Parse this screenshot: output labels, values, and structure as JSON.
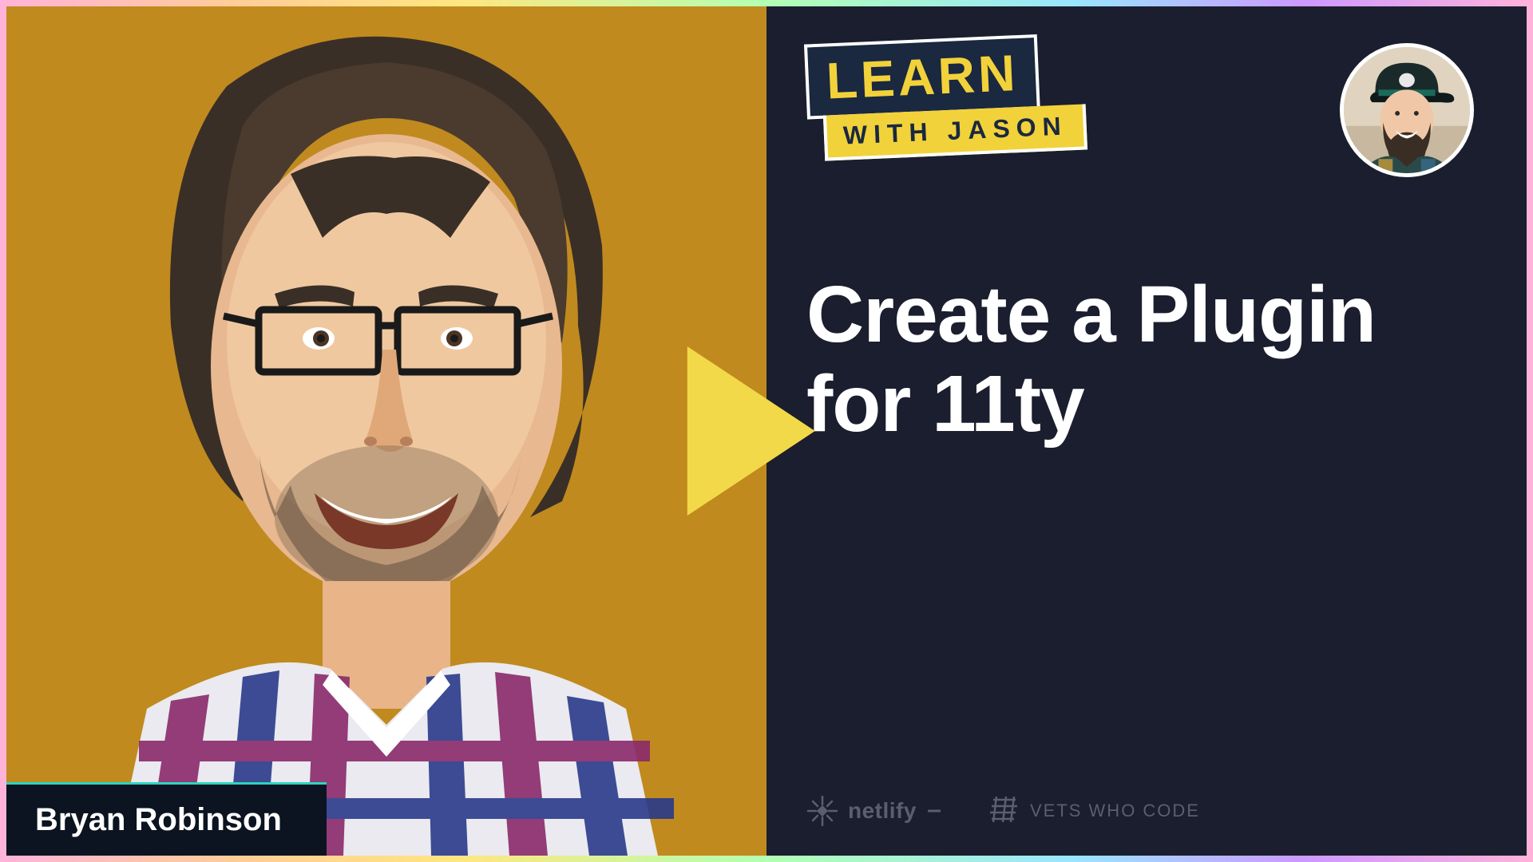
{
  "guest": {
    "name": "Bryan Robinson"
  },
  "logo": {
    "line1": "LEARN",
    "line2": "WITH JASON"
  },
  "episode": {
    "title": "Create a Plugin for 11ty"
  },
  "sponsors": [
    {
      "icon": "netlify-icon",
      "label": "netlify"
    },
    {
      "icon": "vets-who-code-icon",
      "label": "VETS WHO CODE"
    }
  ],
  "icons": {
    "play": "play-icon",
    "host_avatar": "host-avatar"
  }
}
